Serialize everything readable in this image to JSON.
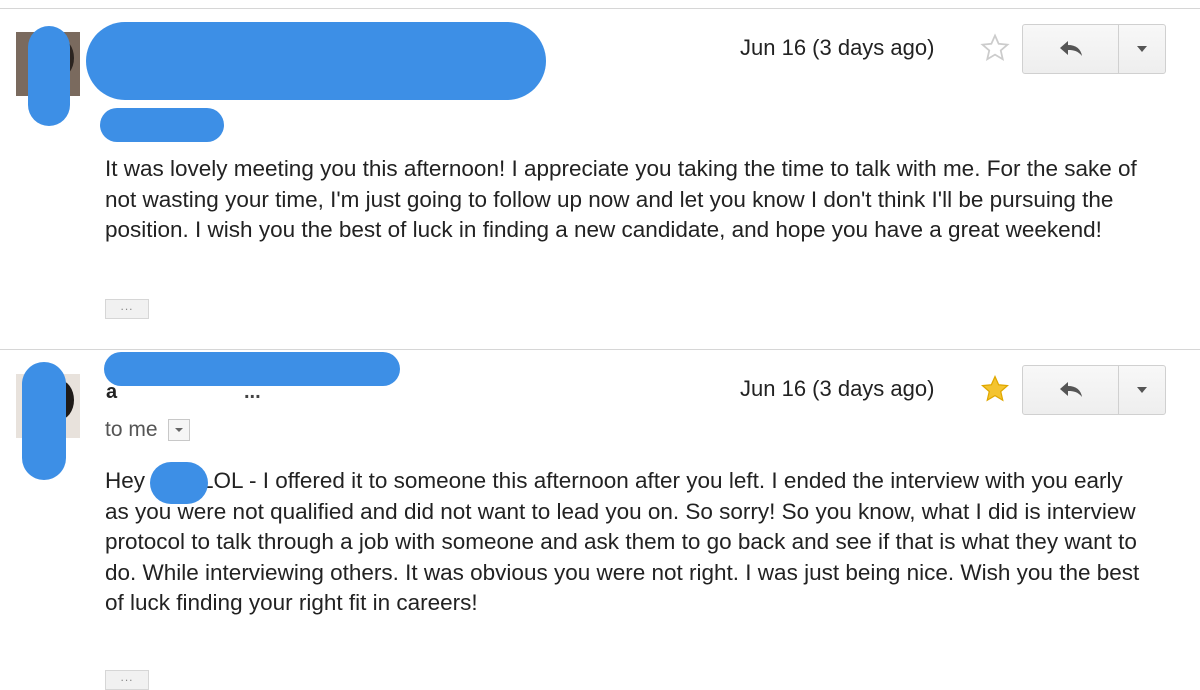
{
  "messages": [
    {
      "sender": "",
      "to": "",
      "date": "Jun 16 (3 days ago)",
      "starred": false,
      "body": "It was lovely meeting you this afternoon! I appreciate you taking the time to talk with me. For the sake of not wasting your time, I'm just going to follow up now and let you know I don't think I'll be pursuing the position. I wish you the best of luck in finding a new candidate, and hope you have a great weekend!",
      "ellipsis": "..."
    },
    {
      "sender": "a",
      "to": "to me",
      "date": "Jun 16 (3 days ago)",
      "starred": true,
      "body_greeting": "Hey",
      "body": "LOL - I offered it to someone this afternoon after you left. I ended the interview with you early as you were not qualified and did not want to lead you on. So sorry! So you know, what I did is interview protocol to talk through a job with someone and ask them to go back and see if that is what they want to do. While interviewing others. It was obvious you were not right. I was just being nice. Wish you the best of luck finding your right fit in careers!",
      "ellipsis": "..."
    }
  ],
  "colors": {
    "redaction": "#3d8fe6",
    "star_on": "#f4c430",
    "star_off": "#cccccc"
  },
  "icons": {
    "reply": "reply-arrow-icon",
    "more": "caret-down-icon",
    "star": "star-icon"
  }
}
